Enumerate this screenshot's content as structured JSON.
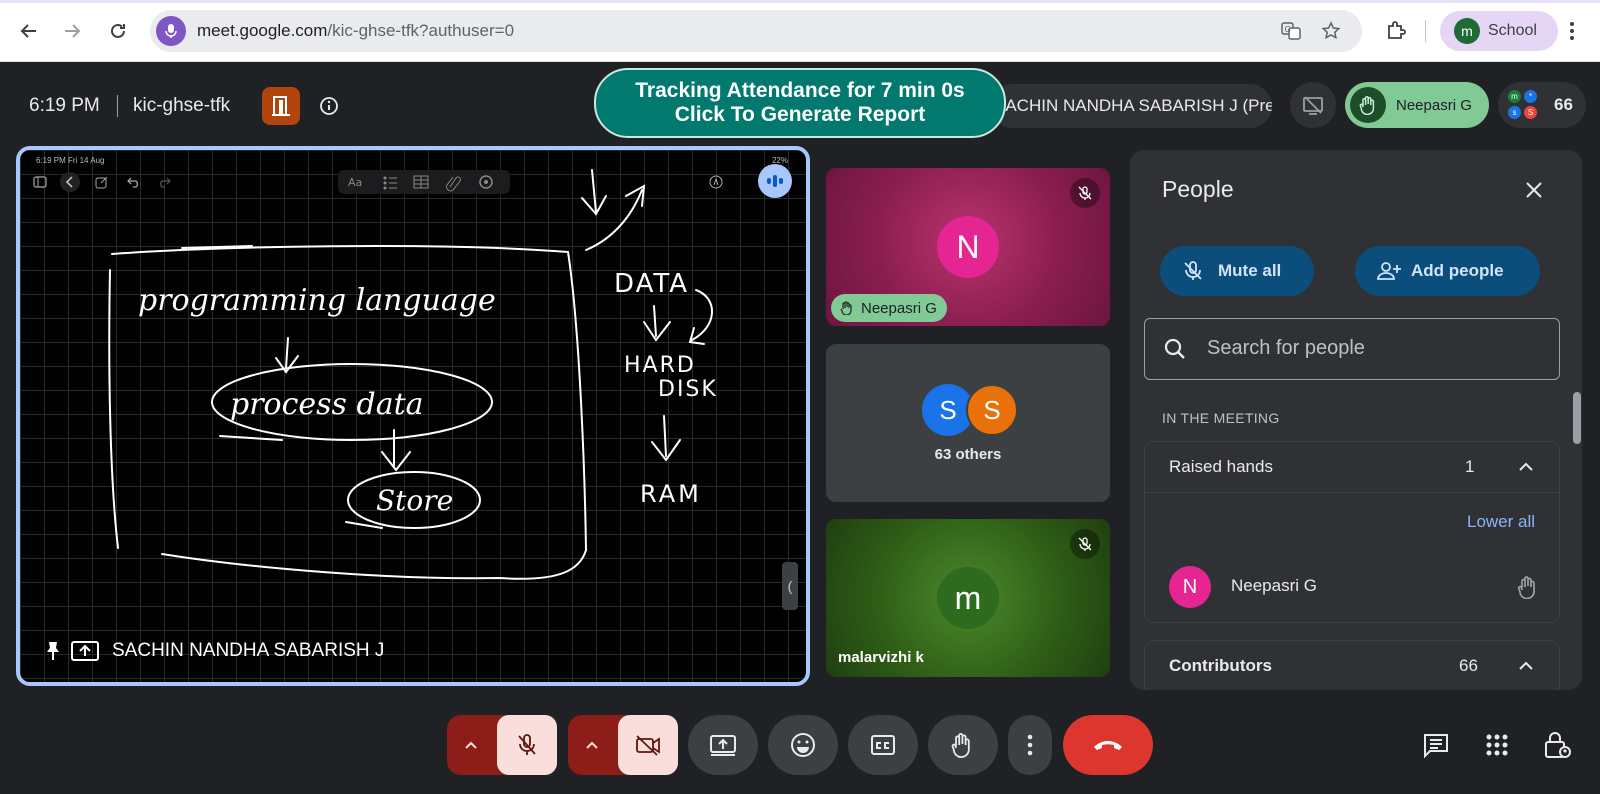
{
  "browser": {
    "url_host": "meet.google.com",
    "url_path": "/kic-ghse-tfk?authuser=0",
    "profile_initial": "m",
    "profile_label": "School"
  },
  "meeting": {
    "time": "6:19 PM",
    "code": "kic-ghse-tfk",
    "attendance_line1": "Tracking Attendance for 7 min 0s",
    "attendance_line2": "Click To Generate Report",
    "presenting_label": "SACHIN NANDHA SABARISH J (Presenting)",
    "raised_hand_pill": "Neepasri G",
    "participant_count": "66",
    "mini_avatars": [
      "m",
      "*",
      "s",
      "S"
    ]
  },
  "presentation": {
    "status_left": "6:19 PM   Fri 14 Aug",
    "status_right": "22%",
    "presenter_name": "SACHIN NANDHA SABARISH J",
    "handwriting": {
      "title": "programming language",
      "box1": "process data",
      "box2": "Store",
      "data": "DATA",
      "hard": "HARD",
      "disk": "DISK",
      "ram": "RAM"
    }
  },
  "tiles": [
    {
      "initial": "N",
      "name": "Neepasri G"
    },
    {
      "initials": [
        "S",
        "S"
      ],
      "caption": "63 others"
    },
    {
      "initial": "m",
      "name": "malarvizhi k"
    }
  ],
  "panel": {
    "title": "People",
    "mute_all": "Mute all",
    "add_people": "Add people",
    "search_placeholder": "Search for people",
    "in_meeting": "IN THE MEETING",
    "raised_hands_label": "Raised hands",
    "raised_hands_count": "1",
    "lower_all": "Lower all",
    "raised_person_initial": "N",
    "raised_person_name": "Neepasri G",
    "contributors_label": "Contributors",
    "contributors_count": "66"
  },
  "colors": {
    "accent_blue": "#a8c7fa",
    "attendance_green": "#01796f",
    "end_call_red": "#dc362e",
    "raised_hand_green": "#81c995"
  }
}
